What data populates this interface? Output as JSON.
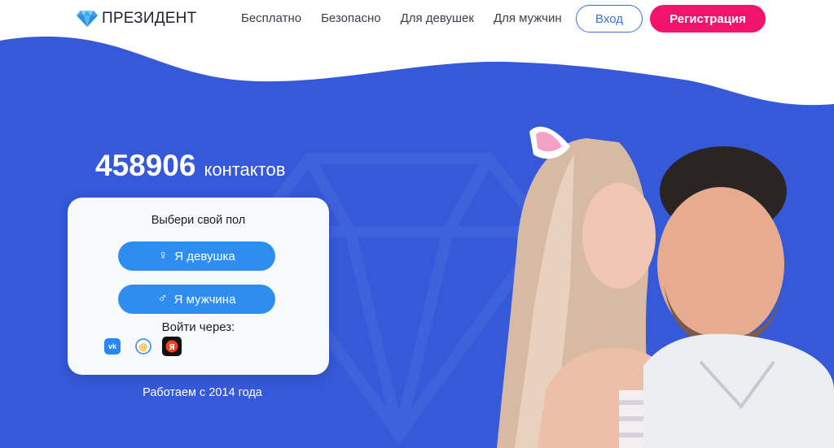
{
  "header": {
    "logo_text": "ПРЕЗИДЕНТ",
    "nav": [
      "Бесплатно",
      "Безопасно",
      "Для девушек",
      "Для мужчин"
    ],
    "login_label": "Вход",
    "register_label": "Регистрация"
  },
  "hero": {
    "count": "458906",
    "count_label": "контактов",
    "since": "Работаем с 2014 года"
  },
  "card": {
    "title": "Выбери свой пол",
    "female_label": "Я девушка",
    "male_label": "Я мужчина",
    "login_via": "Войти через:",
    "social": [
      "vk-icon",
      "mail-ru-icon",
      "yandex-icon"
    ]
  },
  "colors": {
    "background": "#3659d9",
    "accent_blue": "#2d8ef0",
    "register_pink": "#f2136d",
    "login_border": "#3c6fdc"
  }
}
